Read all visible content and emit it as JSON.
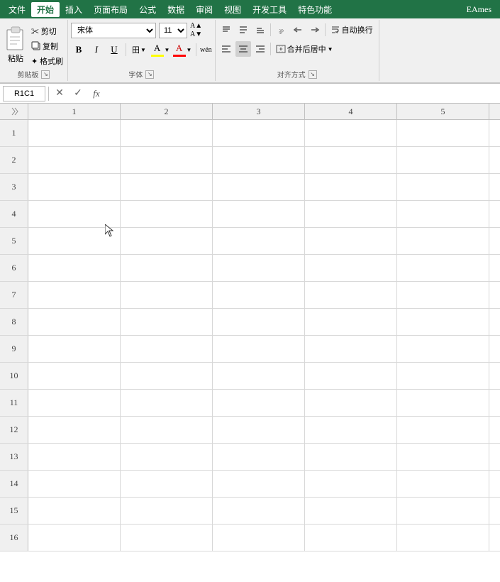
{
  "menubar": {
    "items": [
      "文件",
      "开始",
      "插入",
      "页面布局",
      "公式",
      "数据",
      "审阅",
      "视图",
      "开发工具",
      "特色功能"
    ],
    "active": "开始"
  },
  "ribbon": {
    "clipboard": {
      "label": "剪贴板",
      "paste": "粘贴",
      "cut": "✂ 剪切",
      "copy": "复制",
      "format_painter": "✦ 格式刷"
    },
    "font": {
      "label": "字体",
      "name": "宋体",
      "size": "11",
      "bold": "B",
      "italic": "I",
      "underline": "U",
      "border_label": "田",
      "highlight_label": "A",
      "font_color_label": "A"
    },
    "alignment": {
      "label": "对齐方式",
      "wrap_text": "自动换行",
      "merge_center": "合并后居中"
    }
  },
  "formula_bar": {
    "cell_ref": "R1C1",
    "cancel": "✕",
    "confirm": "✓",
    "fx": "fx",
    "formula": ""
  },
  "spreadsheet": {
    "col_headers": [
      "1",
      "2",
      "3",
      "4",
      "5"
    ],
    "rows": [
      1,
      2,
      3,
      4,
      5,
      6,
      7,
      8,
      9,
      10,
      11,
      12,
      13,
      14,
      15,
      16
    ]
  },
  "user": {
    "name": "EAmes"
  }
}
